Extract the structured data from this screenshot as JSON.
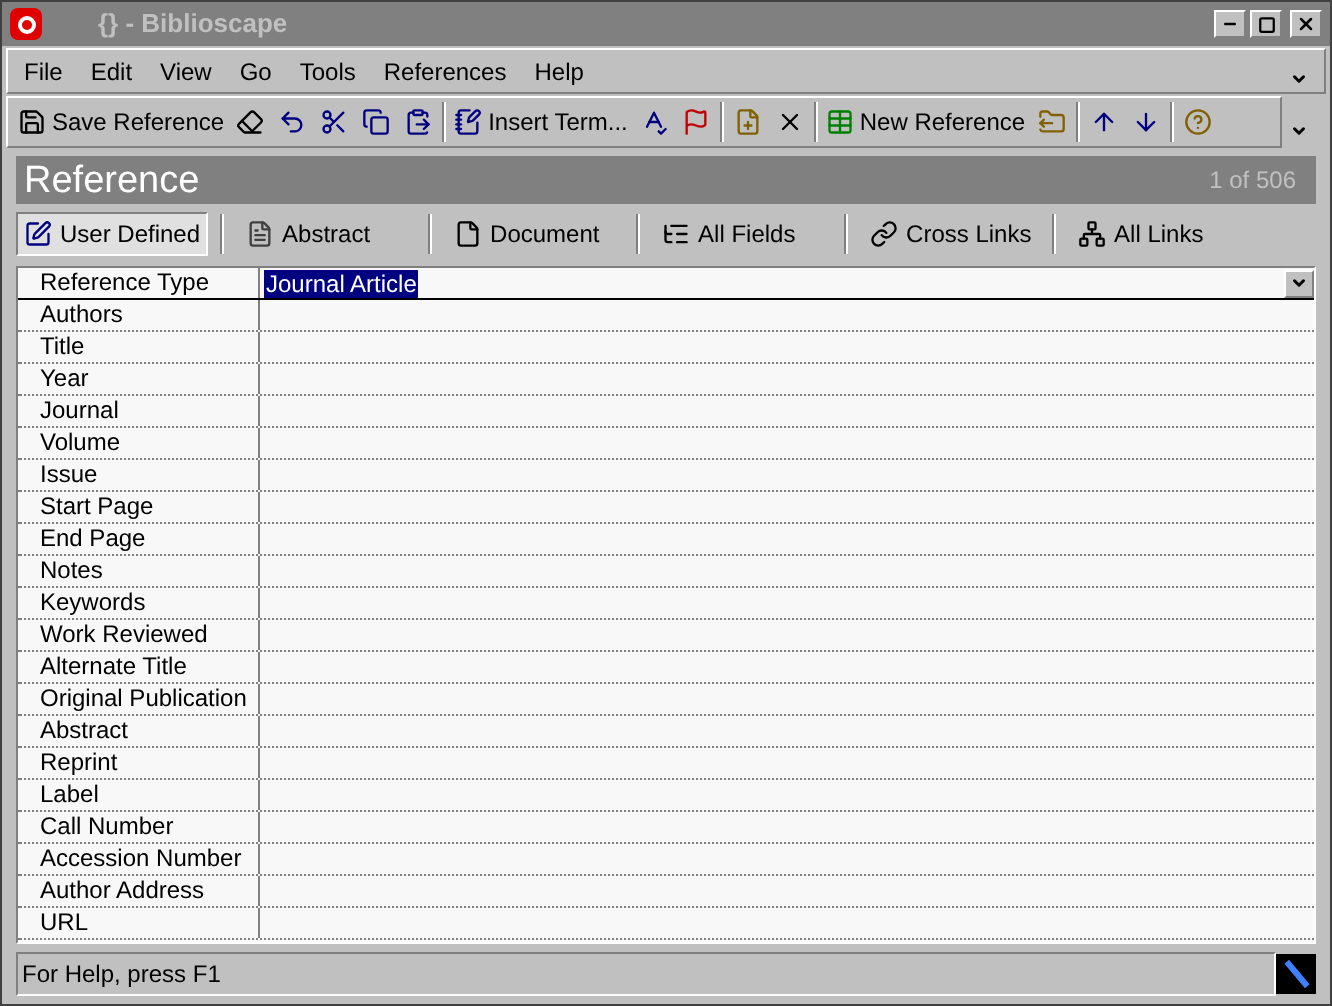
{
  "window": {
    "title": "{} - Biblioscape"
  },
  "menu": [
    "File",
    "Edit",
    "View",
    "Go",
    "Tools",
    "References",
    "Help"
  ],
  "toolbar": [
    {
      "kind": "labeled",
      "label": "Save Reference"
    },
    {
      "kind": "icon"
    },
    {
      "kind": "icon"
    },
    {
      "kind": "icon"
    },
    {
      "kind": "icon"
    },
    {
      "kind": "icon"
    },
    {
      "kind": "separator"
    },
    {
      "kind": "labeled",
      "label": "Insert Term..."
    },
    {
      "kind": "icon"
    },
    {
      "kind": "icon"
    },
    {
      "kind": "separator"
    },
    {
      "kind": "icon"
    },
    {
      "kind": "icon"
    },
    {
      "kind": "separator"
    },
    {
      "kind": "labeled",
      "label": "New Reference"
    },
    {
      "kind": "icon"
    },
    {
      "kind": "separator"
    },
    {
      "kind": "icon"
    },
    {
      "kind": "icon"
    },
    {
      "kind": "separator"
    },
    {
      "kind": "icon"
    }
  ],
  "header": {
    "title": "Reference",
    "counter": "1 of 506"
  },
  "tabs": [
    {
      "label": "User Defined",
      "selected": true
    },
    {
      "label": "Abstract",
      "selected": false
    },
    {
      "label": "Document",
      "selected": false
    },
    {
      "label": "All Fields",
      "selected": false
    },
    {
      "label": "Cross Links",
      "selected": false
    },
    {
      "label": "All Links",
      "selected": false
    }
  ],
  "fields": [
    {
      "label": "Reference Type",
      "value": "Journal Article",
      "kind": "dropdown"
    },
    {
      "label": "Authors"
    },
    {
      "label": "Title"
    },
    {
      "label": "Year"
    },
    {
      "label": "Journal"
    },
    {
      "label": "Volume"
    },
    {
      "label": "Issue"
    },
    {
      "label": "Start Page"
    },
    {
      "label": "End Page"
    },
    {
      "label": "Notes"
    },
    {
      "label": "Keywords"
    },
    {
      "label": "Work Reviewed"
    },
    {
      "label": "Alternate Title"
    },
    {
      "label": "Original Publication"
    },
    {
      "label": "Abstract"
    },
    {
      "label": "Reprint"
    },
    {
      "label": "Label"
    },
    {
      "label": "Call Number"
    },
    {
      "label": "Accession Number"
    },
    {
      "label": "Author Address"
    },
    {
      "label": "URL"
    }
  ],
  "status_bar": {
    "text": "For Help, press F1"
  }
}
